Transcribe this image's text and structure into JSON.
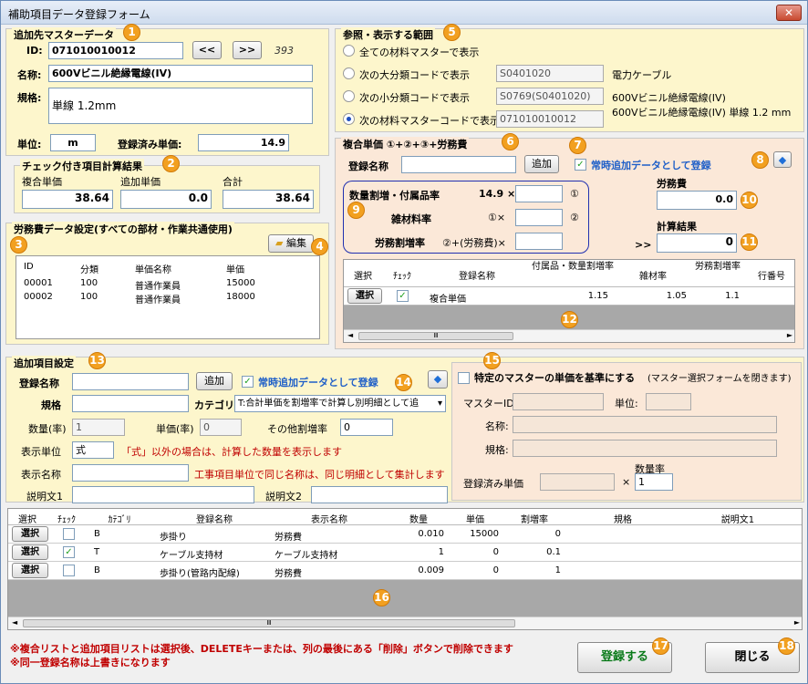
{
  "window": {
    "title": "補助項目データ登録フォーム",
    "close": "✕"
  },
  "master": {
    "title": "追加先マスターデータ",
    "id_label": "ID:",
    "id_value": "071010010012",
    "prev": "<<",
    "next": ">>",
    "count": "393",
    "name_label": "名称:",
    "name_value": "600Vビニル絶縁電線(IV)",
    "spec_label": "規格:",
    "spec_value": "単線 1.2mm",
    "unit_label": "単位:",
    "unit_value": "m",
    "price_label": "登録済み単価:",
    "price_value": "14.9"
  },
  "check_result": {
    "title": "チェック付き項目計算結果",
    "h1": "複合単価",
    "h2": "追加単価",
    "h3": "合計",
    "v1": "38.64",
    "v2": "0.0",
    "v3": "38.64"
  },
  "labor": {
    "title": "労務費データ設定(すべての部材・作業共通使用)",
    "edit": "編集",
    "headers": [
      "ID",
      "分類",
      "単価名称",
      "単価"
    ],
    "rows": [
      [
        "00001",
        "100",
        "普通作業員",
        "15000"
      ],
      [
        "00002",
        "100",
        "普通作業員",
        "18000"
      ]
    ]
  },
  "ref": {
    "title": "参照・表示する範囲",
    "r1": "全ての材料マスターで表示",
    "r2": "次の大分類コードで表示",
    "r2_code": "S0401020",
    "r2_name": "電力ケーブル",
    "r3": "次の小分類コードで表示",
    "r3_code": "S0769(S0401020)",
    "r3_name": "600Vビニル絶縁電線(IV)",
    "r4": "次の材料マスターコードで表示",
    "r4_code": "071010010012",
    "r4_name": "600Vビニル絶縁電線(IV) 単線 1.2 mm"
  },
  "compound": {
    "title": "複合単価 ①+②+③+労務費",
    "reg_label": "登録名称",
    "add": "追加",
    "always": "常時追加データとして登録",
    "rate1_label": "数量割増・付属品率",
    "rate1_val": "14.9 ×",
    "c1": "①",
    "rate2_label": "雑材料率",
    "rate2_val": "①×",
    "c2": "②",
    "rate3_label": "労務割増率",
    "rate3_val": "②+(労務費)×",
    "labor_label": "労務費",
    "labor_value": "0.0",
    "calc_label": "計算結果",
    "arrow": ">>",
    "calc_value": "0",
    "headers": [
      "選択",
      "ﾁｪｯｸ",
      "登録名称",
      "付属品・数量割増率",
      "雑材率",
      "労務割増率",
      "行番号"
    ],
    "row": {
      "select": "選択",
      "name": "複合単価",
      "r1": "1.15",
      "r2": "1.05",
      "r3": "1.1"
    }
  },
  "add_items": {
    "title": "追加項目設定",
    "reg_label": "登録名称",
    "add": "追加",
    "always": "常時追加データとして登録",
    "spec_label": "規格",
    "cat_label": "カテゴリ",
    "cat_value": "T:合計単価を割増率で計算し別明細として追",
    "qty_label": "数量(率)",
    "qty_value": "1",
    "unit_price_label": "単価(率)",
    "unit_price_value": "0",
    "other_label": "その他割増率",
    "other_value": "0",
    "disp_unit_label": "表示単位",
    "disp_unit_value": "式",
    "disp_unit_note": "「式」以外の場合は、計算した数量を表示します",
    "disp_name_label": "表示名称",
    "disp_name_note": "工事項目単位で同じ名称は、同じ明細として集計します",
    "desc1_label": "説明文1",
    "desc2_label": "説明文2"
  },
  "special": {
    "title": "特定のマスターの単価を基準にする",
    "note": "(マスター選択フォームを閉きます)",
    "master_id": "マスターID:",
    "unit": "単位:",
    "name": "名称:",
    "spec": "規格:",
    "price": "登録済み単価",
    "times": "×",
    "qty_rate": "数量率",
    "qty_rate_value": "1"
  },
  "items_grid": {
    "headers": [
      "選択",
      "ﾁｪｯｸ",
      "ｶﾃｺﾞﾘ",
      "登録名称",
      "表示名称",
      "数量",
      "単価",
      "割増率",
      "規格",
      "説明文1"
    ],
    "rows": [
      {
        "select": "選択",
        "check": "",
        "cat": "B",
        "name": "歩掛り",
        "disp": "労務費",
        "qty": "0.010",
        "price": "15000",
        "rate": "0"
      },
      {
        "select": "選択",
        "check": "✓",
        "cat": "T",
        "name": "ケーブル支持材",
        "disp": "ケーブル支持材",
        "qty": "1",
        "price": "0",
        "rate": "0.1"
      },
      {
        "select": "選択",
        "check": "",
        "cat": "B",
        "name": "歩掛り(管路内配線)",
        "disp": "労務費",
        "qty": "0.009",
        "price": "0",
        "rate": "1"
      }
    ]
  },
  "footer": {
    "note1": "※複合リストと追加項目リストは選択後、DELETEキーまたは、列の最後にある「削除」ボタンで削除できます",
    "note2": "※同一登録名称は上書きになります",
    "register": "登録する",
    "close": "閉じる"
  },
  "markers": [
    "1",
    "2",
    "3",
    "4",
    "5",
    "6",
    "7",
    "8",
    "9",
    "10",
    "11",
    "12",
    "13",
    "14",
    "15",
    "16",
    "17",
    "18"
  ],
  "scroll": {
    "left": "◄",
    "right": "►",
    "thumb": "Ⅲ"
  }
}
